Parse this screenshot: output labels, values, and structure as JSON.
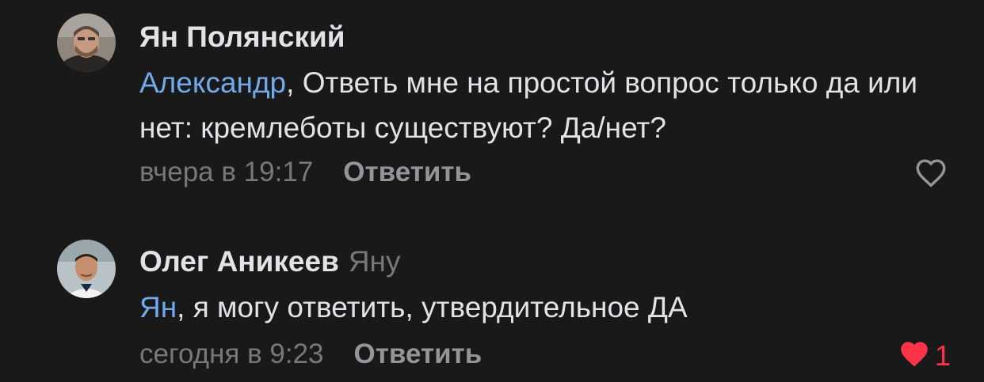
{
  "comments": [
    {
      "author": "Ян Полянский",
      "reply_to": "",
      "mention": "Александр",
      "text_rest": ", Ответь мне на простой вопрос только да или нет: кремлеботы существуют? Да/нет?",
      "time": "вчера в 19:17",
      "reply_label": "Ответить",
      "liked": false,
      "like_count": "",
      "like_icon": "heart-outline-icon"
    },
    {
      "author": "Олег Аникеев",
      "reply_to": "Яну",
      "mention": "Ян",
      "text_rest": ", я могу ответить, утвердительное ДА",
      "time": "сегодня в 9:23",
      "reply_label": "Ответить",
      "liked": true,
      "like_count": "1",
      "like_icon": "heart-filled-icon"
    }
  ],
  "colors": {
    "background": "#19191a",
    "text": "#e1e3e6",
    "mention": "#71aaeb",
    "secondary": "#76787a",
    "like_active": "#ff3347"
  }
}
